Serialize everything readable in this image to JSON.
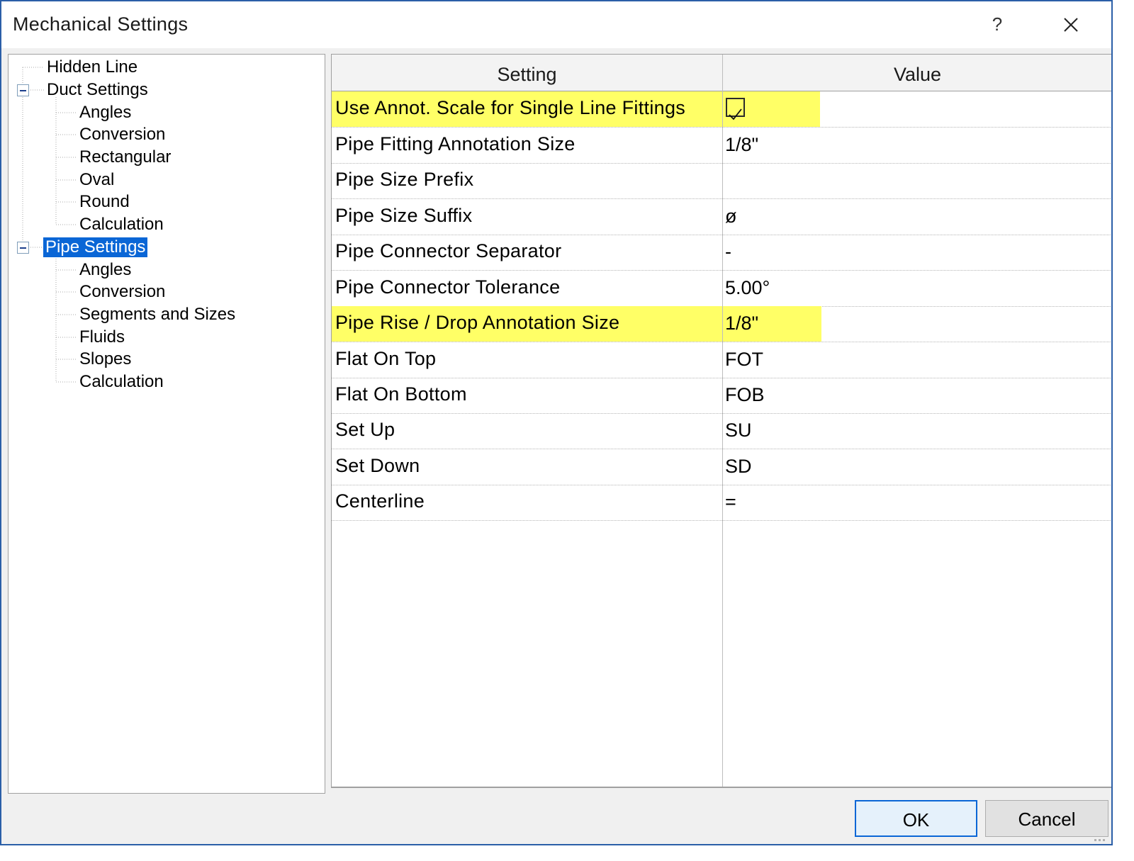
{
  "window": {
    "title": "Mechanical Settings",
    "help_glyph": "?",
    "close_icon": "close-icon"
  },
  "tree": {
    "items": [
      {
        "label": "Hidden Line"
      },
      {
        "label": "Duct Settings",
        "expanded": true
      },
      {
        "label": "Angles"
      },
      {
        "label": "Conversion"
      },
      {
        "label": "Rectangular"
      },
      {
        "label": "Oval"
      },
      {
        "label": "Round"
      },
      {
        "label": "Calculation"
      },
      {
        "label": "Pipe Settings",
        "expanded": true,
        "selected": true
      },
      {
        "label": "Angles"
      },
      {
        "label": "Conversion"
      },
      {
        "label": "Segments and Sizes"
      },
      {
        "label": "Fluids"
      },
      {
        "label": "Slopes"
      },
      {
        "label": "Calculation"
      }
    ]
  },
  "grid": {
    "headers": {
      "setting": "Setting",
      "value": "Value"
    },
    "rows": [
      {
        "setting": "Use Annot. Scale for Single Line Fittings",
        "value": "",
        "checked": true,
        "highlight": true
      },
      {
        "setting": "Pipe Fitting Annotation Size",
        "value": "1/8\""
      },
      {
        "setting": "Pipe Size Prefix",
        "value": ""
      },
      {
        "setting": "Pipe Size Suffix",
        "value": "ø"
      },
      {
        "setting": "Pipe Connector Separator",
        "value": "-"
      },
      {
        "setting": "Pipe Connector Tolerance",
        "value": "5.00°"
      },
      {
        "setting": "Pipe Rise / Drop Annotation Size",
        "value": "1/8\"",
        "highlight": true
      },
      {
        "setting": "Flat On Top",
        "value": "FOT"
      },
      {
        "setting": "Flat On Bottom",
        "value": "FOB"
      },
      {
        "setting": "Set Up",
        "value": "SU"
      },
      {
        "setting": "Set Down",
        "value": "SD"
      },
      {
        "setting": "Centerline",
        "value": "="
      }
    ]
  },
  "buttons": {
    "ok": "OK",
    "cancel": "Cancel"
  },
  "colors": {
    "highlight": "#ffff66",
    "selection": "#0a66d6",
    "border_accent": "#2b5fa8"
  }
}
